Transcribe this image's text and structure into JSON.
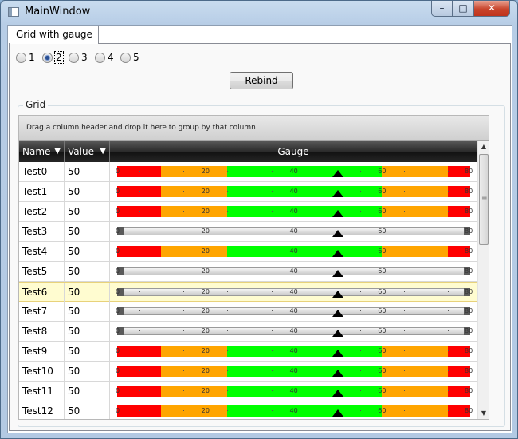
{
  "window": {
    "title": "MainWindow",
    "min_label": "–",
    "max_label": "□",
    "close_label": "✕"
  },
  "tab": {
    "label": "Grid with gauge"
  },
  "radios": [
    {
      "label": "1",
      "checked": false
    },
    {
      "label": "2",
      "checked": true
    },
    {
      "label": "3",
      "checked": false
    },
    {
      "label": "4",
      "checked": false
    },
    {
      "label": "5",
      "checked": false
    }
  ],
  "rebind_label": "Rebind",
  "groupbox_label": "Grid",
  "grid": {
    "group_hint": "Drag a column header and drop it here to group by that column",
    "columns": {
      "name": "Name",
      "value": "Value",
      "gauge": "Gauge"
    },
    "filter_icon": "funnel-icon",
    "rows": [
      {
        "name": "Test0",
        "value": "50",
        "style": "colored"
      },
      {
        "name": "Test1",
        "value": "50",
        "style": "colored"
      },
      {
        "name": "Test2",
        "value": "50",
        "style": "colored"
      },
      {
        "name": "Test3",
        "value": "50",
        "style": "gray"
      },
      {
        "name": "Test4",
        "value": "50",
        "style": "colored"
      },
      {
        "name": "Test5",
        "value": "50",
        "style": "gray"
      },
      {
        "name": "Test6",
        "value": "50",
        "style": "gray",
        "selected": true
      },
      {
        "name": "Test7",
        "value": "50",
        "style": "gray"
      },
      {
        "name": "Test8",
        "value": "50",
        "style": "gray"
      },
      {
        "name": "Test9",
        "value": "50",
        "style": "colored"
      },
      {
        "name": "Test10",
        "value": "50",
        "style": "colored"
      },
      {
        "name": "Test11",
        "value": "50",
        "style": "colored"
      },
      {
        "name": "Test12",
        "value": "50",
        "style": "colored"
      }
    ]
  },
  "gauge_scale": {
    "min": 0,
    "max": 80,
    "labels": [
      "0",
      "20",
      "40",
      "60",
      "80"
    ],
    "ranges": [
      {
        "from": 0,
        "to": 10,
        "color": "#ff0000"
      },
      {
        "from": 10,
        "to": 25,
        "color": "#ffa500"
      },
      {
        "from": 25,
        "to": 60,
        "color": "#00ff00"
      },
      {
        "from": 60,
        "to": 75,
        "color": "#ffa500"
      },
      {
        "from": 75,
        "to": 80,
        "color": "#ff0000"
      }
    ]
  },
  "colors": {
    "header_bg": "#1f1f1f",
    "selected_row": "#fffcd0",
    "close_button": "#c8442b"
  }
}
